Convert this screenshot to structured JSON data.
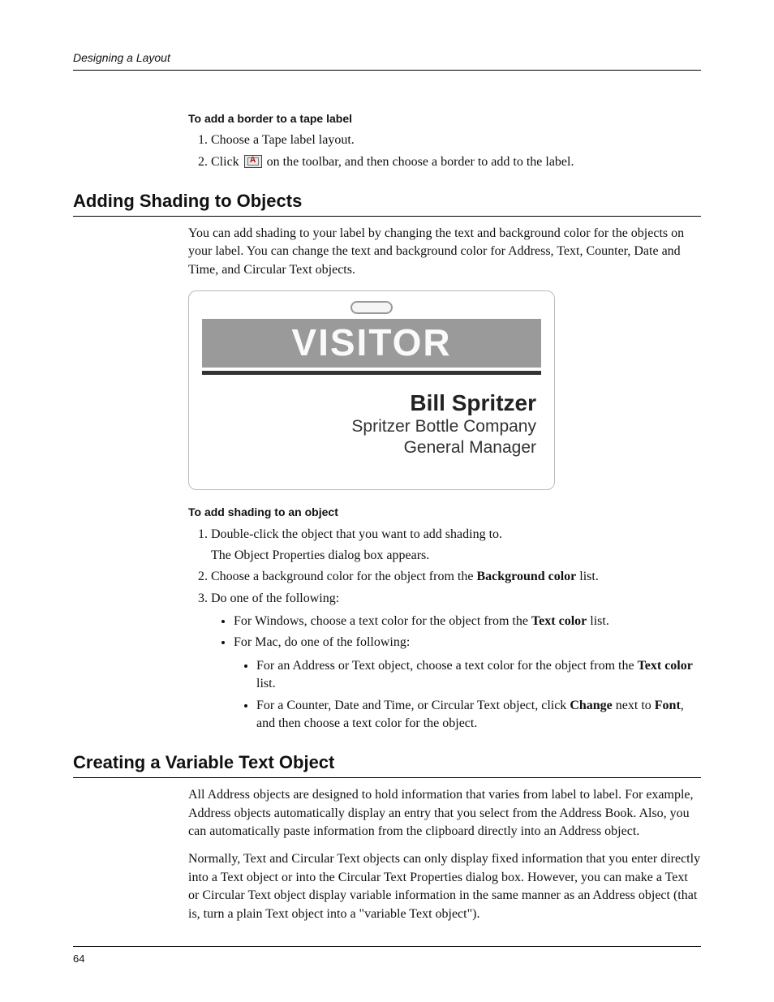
{
  "running_head": "Designing a Layout",
  "page_number": "64",
  "proc1": {
    "title": "To add a border to a tape label",
    "step1": "Choose a Tape label layout.",
    "step2_prefix": "Click ",
    "step2_suffix": " on the toolbar, and then choose a border to add to the label."
  },
  "section_shading": {
    "heading": "Adding Shading to Objects",
    "intro": "You can add shading to your label by changing the text and background color for the objects on your label. You can change the text and background color for Address, Text, Counter, Date and Time, and Circular Text objects.",
    "label": {
      "band": "VISITOR",
      "name": "Bill Spritzer",
      "company": "Spritzer Bottle Company",
      "role": "General Manager"
    },
    "proc": {
      "title": "To add shading to an object",
      "s1": "Double-click the object that you want to add shading to.",
      "s1b": "The Object Properties dialog box appears.",
      "s2a": "Choose a background color for the object from the ",
      "s2b": "Background color",
      "s2c": " list.",
      "s3": "Do one of the following:",
      "b1a": "For Windows, choose a text color for the object from the ",
      "b1b": "Text color",
      "b1c": " list.",
      "b2": "For Mac, do one of the following:",
      "bb1a": "For an Address or Text object, choose a text color for the object from the ",
      "bb1b": "Text color",
      "bb1c": " list.",
      "bb2a": "For a Counter, Date and Time, or Circular Text object, click ",
      "bb2b": "Change",
      "bb2c": " next to ",
      "bb2d": "Font",
      "bb2e": ", and then choose a text color for the object."
    }
  },
  "section_var": {
    "heading": "Creating a Variable Text Object",
    "p1": "All Address objects are designed to hold information that varies from label to label. For example, Address objects automatically display an entry that you select from the Address Book. Also, you can automatically paste information from the clipboard directly into an Address object.",
    "p2": "Normally, Text and Circular Text objects can only display fixed information that you enter directly into a Text object or into the Circular Text Properties dialog box. However, you can make a Text or Circular Text object display variable information in the same manner as an Address object (that is, turn a plain Text object into a \"variable Text object\")."
  }
}
